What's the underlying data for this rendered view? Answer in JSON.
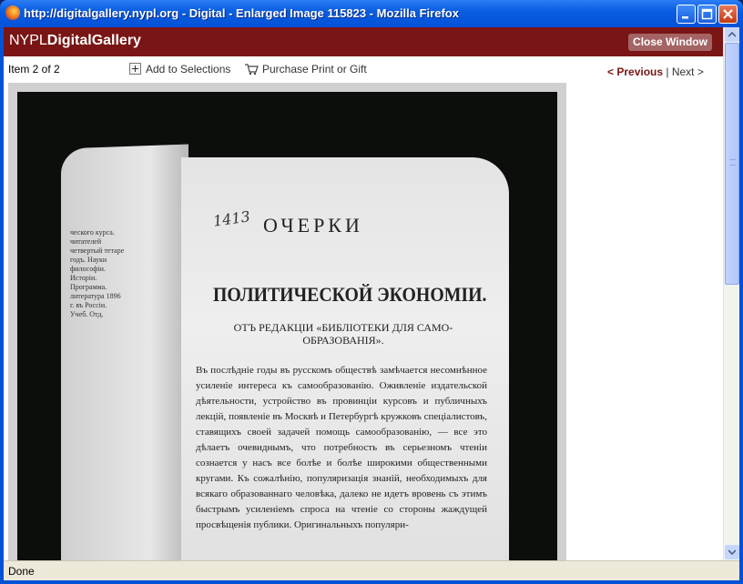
{
  "window": {
    "title": "http://digitalgallery.nypl.org - Digital - Enlarged Image 115823 - Mozilla Firefox"
  },
  "header": {
    "logo_nypl": "NYPL",
    "logo_gallery": "DigitalGallery",
    "close_window_label": "Close Window"
  },
  "toolbar": {
    "item_count": "Item 2 of 2",
    "add_to_selections": "Add to Selections",
    "purchase_print": "Purchase Print or Gift",
    "previous_label": "< Previous",
    "separator": "|",
    "next_label": "Next >"
  },
  "scan": {
    "page_title": "ОЧЕРКИ",
    "page_subtitle": "ПОЛИТИЧЕСКОЙ ЭКОНОМІИ.",
    "editorial": "ОТЪ РЕДАКЦІИ «БИБЛІОТЕКИ ДЛЯ САМО-ОБРАЗОВАНІЯ».",
    "body": "Въ послѣдніе годы въ русскомъ обществѣ замѣчается несомнѣнное усиленіе интереса къ самообразованію. Оживленіе издательской дѣятельности, устройство въ провинціи курсовъ и публичныхъ лекцій, появленіе въ Москвѣ и Петербургѣ кружковъ спеціалистовъ, ставящихъ своей задачей помощь самообразованію, — все это дѣлаетъ очевиднымъ, что потребность въ серьезномъ чтеніи сознается у насъ все болѣе и болѣе широкими общественными кругами. Къ сожалѣнію, популяризація знаній, необходимыхъ для всякаго образованнаго человѣка, далеко не идетъ вровень съ этимъ быстрымъ усиленіемъ спроса на чтеніе со стороны жаждущей просвѣщенія публики. Оригинальныхъ популяри-",
    "handwriting": "1413",
    "left_column": "ческого курса. читателей четвертый тетаре годъ. Науки философіи. Исторіи. Программа. литература 1896 г. въ Россіи. Учеб. Отд."
  },
  "status": {
    "text": "Done"
  }
}
